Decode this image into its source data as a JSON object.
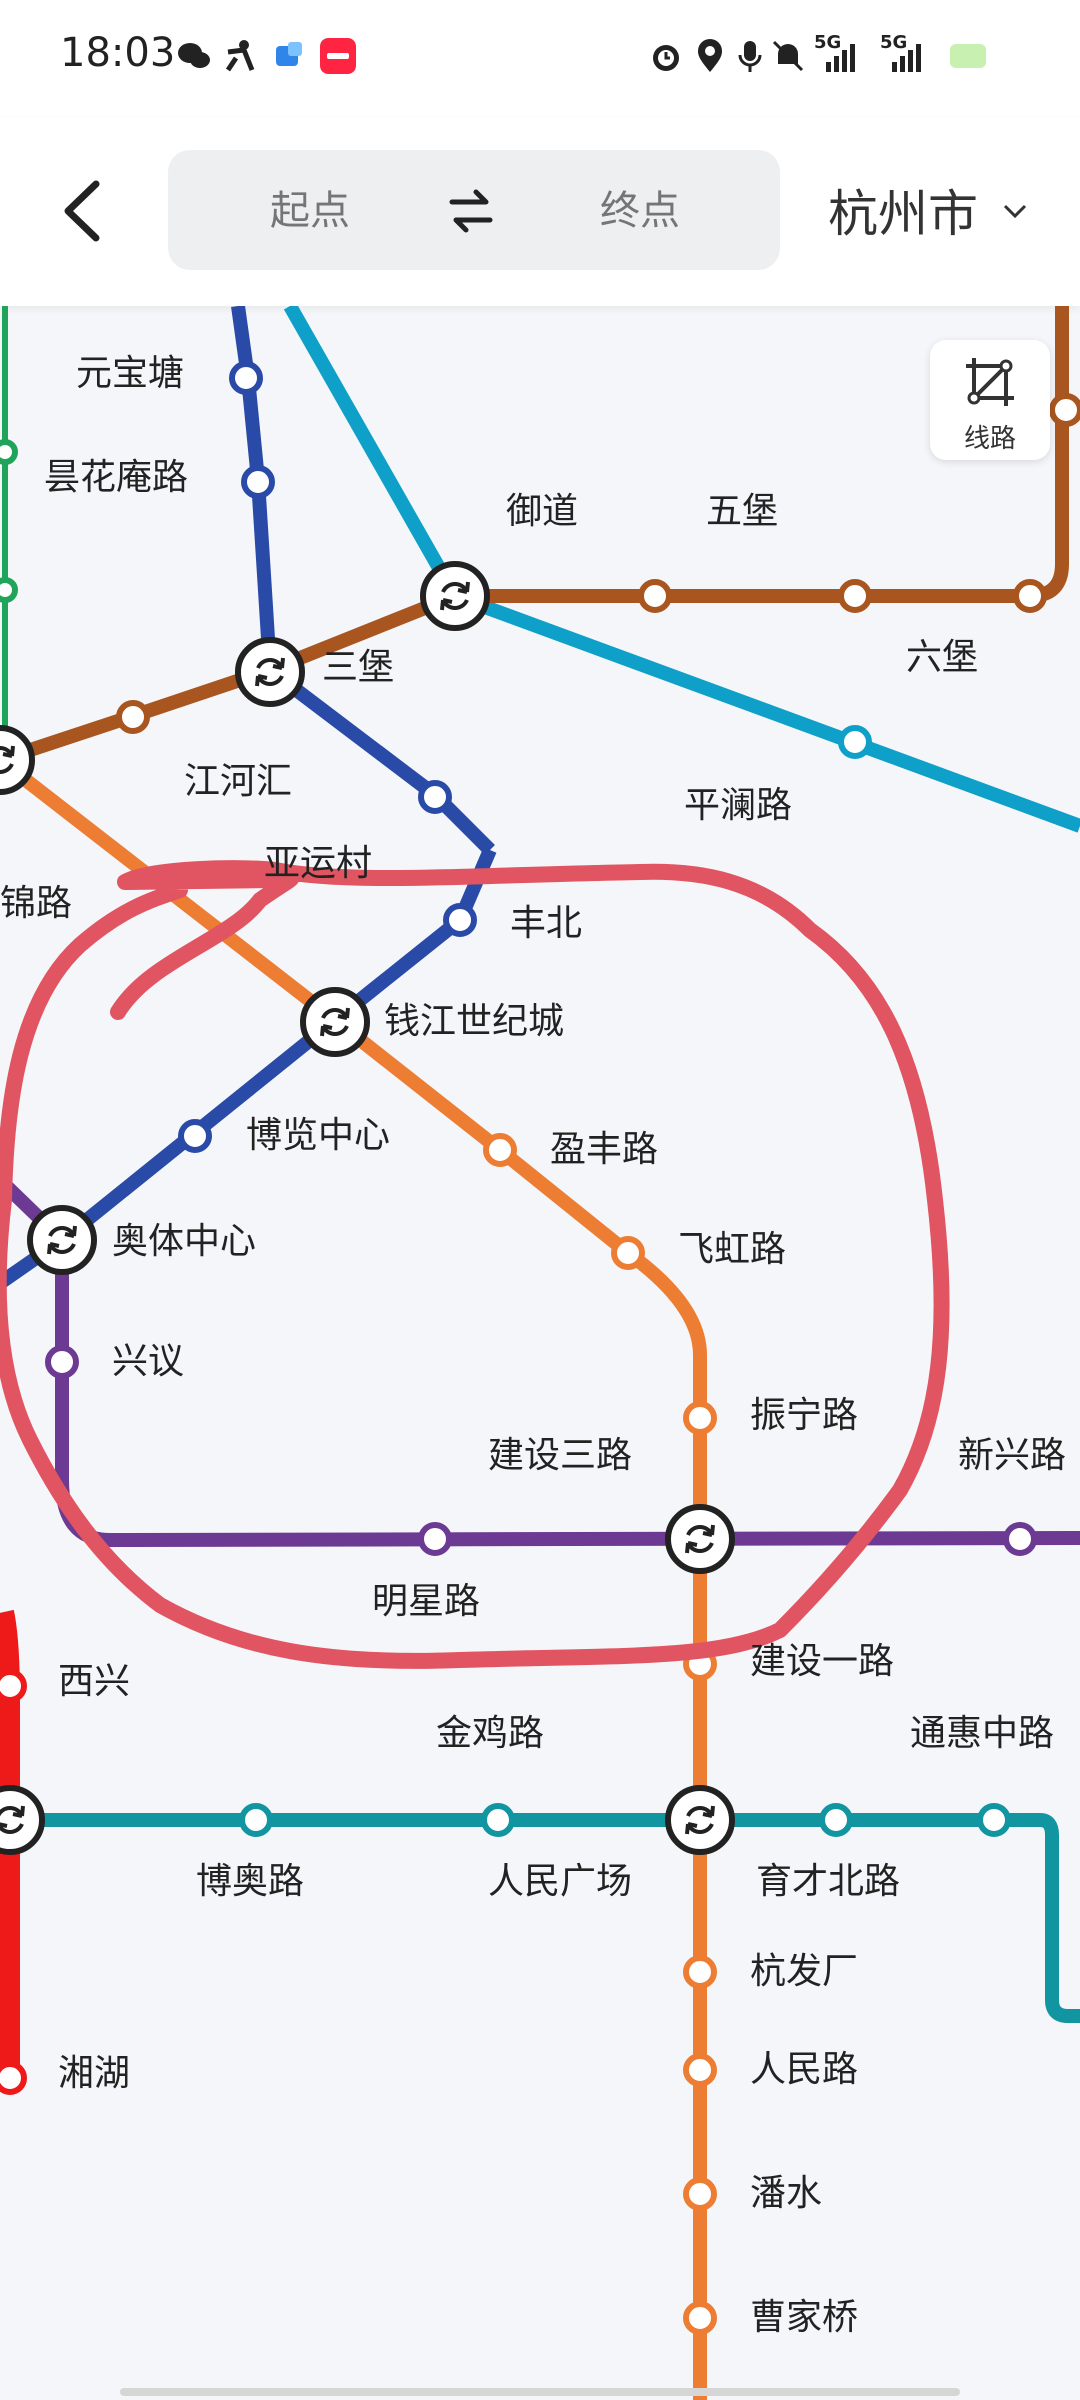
{
  "status_bar": {
    "time": "18:03",
    "net1": "5G",
    "net2": "5G",
    "icons": [
      "wechat-icon",
      "person-icon",
      "app-icon",
      "xiaohongshu-icon",
      "alarm-icon",
      "location-icon",
      "mic-icon",
      "mute-icon",
      "signal-icon",
      "battery-icon"
    ]
  },
  "header": {
    "start_placeholder": "起点",
    "end_placeholder": "终点",
    "city": "杭州市"
  },
  "line_button": {
    "label": "线路"
  },
  "stations": [
    "元宝塘",
    "昙花庵路",
    "御道",
    "五堡",
    "三堡",
    "六堡",
    "江河汇",
    "平澜路",
    "亚运村",
    "锦路",
    "丰北",
    "钱江世纪城",
    "博览中心",
    "盈丰路",
    "奥体中心",
    "飞虹路",
    "兴议",
    "振宁路",
    "建设三路",
    "新兴路",
    "明星路",
    "西兴",
    "建设一路",
    "金鸡路",
    "通惠中路",
    "博奥路",
    "人民广场",
    "育才北路",
    "杭发厂",
    "湘湖",
    "人民路",
    "潘水",
    "曹家桥"
  ],
  "colors": {
    "line1_red": "#ee1a1a",
    "line4_green": "#1fa45a",
    "line5_teal": "#1195a0",
    "line6_navy": "#2a4aa8",
    "line7_purple": "#6c3a92",
    "line8_brown": "#a9551f",
    "line9_cyan": "#0ea0c8",
    "line_orange": "#ec7d33",
    "annotation_pink": "#e05561"
  }
}
